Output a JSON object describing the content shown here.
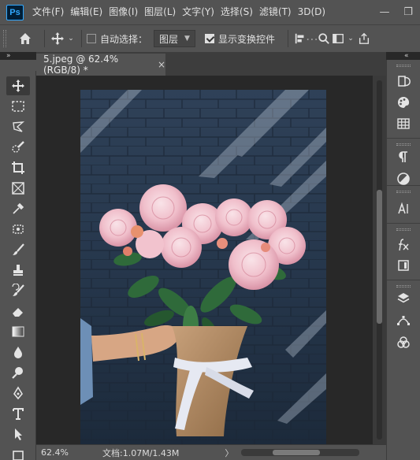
{
  "app": {
    "logo_text": "Ps"
  },
  "menu": [
    {
      "label": "文件(F)"
    },
    {
      "label": "编辑(E)"
    },
    {
      "label": "图像(I)"
    },
    {
      "label": "图层(L)"
    },
    {
      "label": "文字(Y)"
    },
    {
      "label": "选择(S)"
    },
    {
      "label": "滤镜(T)"
    },
    {
      "label": "3D(D)"
    }
  ],
  "window_controls": {
    "minimize": "—",
    "restore": "❐"
  },
  "options": {
    "auto_select_label": "自动选择：",
    "auto_select_checked": false,
    "layer_select_value": "图层",
    "show_transform_label": "显示变换控件",
    "show_transform_checked": true
  },
  "document_tab": {
    "title": "5.jpeg @ 62.4%(RGB/8) *",
    "close": "×"
  },
  "panel_collapse": {
    "left": "»",
    "right": "«"
  },
  "status": {
    "zoom": "62.4%",
    "doc_info": "文档:1.07M/1.43M",
    "arrow": "〉"
  },
  "colors": {
    "chrome": "#535353",
    "canvas_bg": "#282828",
    "accent": "#31a8ff"
  }
}
